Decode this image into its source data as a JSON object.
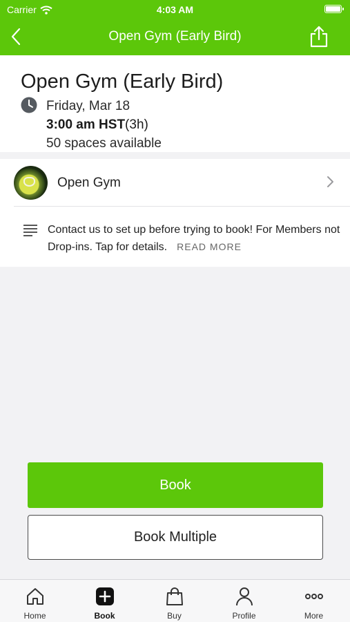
{
  "status_bar": {
    "carrier": "Carrier",
    "time": "4:03 AM"
  },
  "nav": {
    "title": "Open Gym (Early Bird)"
  },
  "event": {
    "title": "Open Gym (Early Bird)",
    "date": "Friday, Mar 18",
    "time_bold": "3:00 am HST",
    "duration": "(3h)",
    "spaces": "50 spaces available"
  },
  "category": {
    "label": "Open Gym"
  },
  "description": {
    "text": "Contact us to set up before trying to book! For Members not Drop-ins. Tap for details.",
    "read_more": "READ MORE"
  },
  "actions": {
    "book": "Book",
    "book_multiple": "Book Multiple"
  },
  "tabs": [
    {
      "label": "Home",
      "icon": "home-icon"
    },
    {
      "label": "Book",
      "icon": "plus-square-icon",
      "active": true
    },
    {
      "label": "Buy",
      "icon": "shopping-bag-icon"
    },
    {
      "label": "Profile",
      "icon": "person-icon"
    },
    {
      "label": "More",
      "icon": "ellipsis-icon"
    }
  ],
  "colors": {
    "brand_green": "#5cc70a",
    "background": "#f2f2f4"
  }
}
